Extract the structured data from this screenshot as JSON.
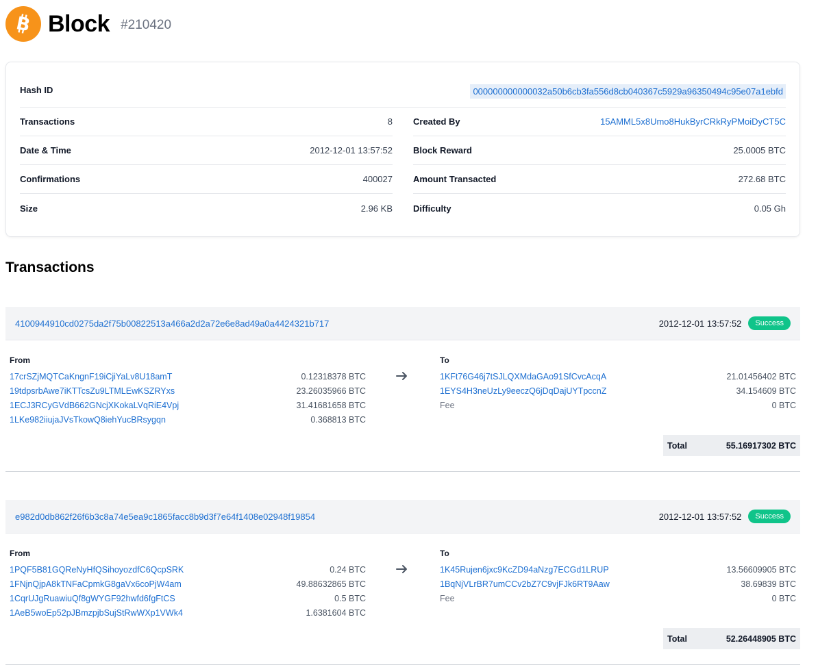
{
  "header": {
    "title": "Block",
    "block_number": "#210420"
  },
  "summary": {
    "hash_label": "Hash ID",
    "hash_value": "000000000000032a50b6cb3fa556d8cb040367c5929a96350494c95e07a1ebfd",
    "left": [
      {
        "label": "Transactions",
        "value": "8"
      },
      {
        "label": "Date & Time",
        "value": "2012-12-01 13:57:52"
      },
      {
        "label": "Confirmations",
        "value": "400027"
      },
      {
        "label": "Size",
        "value": "2.96 KB"
      }
    ],
    "right": [
      {
        "label": "Created By",
        "value": "15AMML5x8Umo8HukByrCRkRyPMoiDyCT5C"
      },
      {
        "label": "Block Reward",
        "value": "25.0005 BTC"
      },
      {
        "label": "Amount Transacted",
        "value": "272.68 BTC"
      },
      {
        "label": "Difficulty",
        "value": "0.05 Gh"
      }
    ]
  },
  "transactions_title": "Transactions",
  "labels": {
    "from": "From",
    "to": "To",
    "total": "Total"
  },
  "transactions": [
    {
      "hash": "4100944910cd0275da2f75b00822513a466a2d2a72e6e8ad49a0a4424321b717",
      "time": "2012-12-01 13:57:52",
      "status": "Success",
      "inputs": [
        {
          "address": "17crSZjMQTCaKngnF19iCjiYaLv8U18amT",
          "amount": "0.12318378 BTC"
        },
        {
          "address": "19tdpsrbAwe7iKTTcsZu9LTMLEwKSZRYxs",
          "amount": "23.26035966 BTC"
        },
        {
          "address": "1ECJ3RCyGVdB662GNcjXKokaLVqRiE4Vpj",
          "amount": "31.41681658 BTC"
        },
        {
          "address": "1LKe982iiujaJVsTkowQ8iehYucBRsygqn",
          "amount": "0.368813 BTC"
        }
      ],
      "outputs": [
        {
          "address": "1KFt76G46j7tSJLQXMdaGAo91SfCvcAcqA",
          "amount": "21.01456402 BTC"
        },
        {
          "address": "1EYS4H3neUzLy9eeczQ6jDqDajUYTpccnZ",
          "amount": "34.154609 BTC"
        }
      ],
      "fee_label": "Fee",
      "fee": "0 BTC",
      "total": "55.16917302 BTC"
    },
    {
      "hash": "e982d0db862f26f6b3c8a74e5ea9c1865facc8b9d3f7e64f1408e02948f19854",
      "time": "2012-12-01 13:57:52",
      "status": "Success",
      "inputs": [
        {
          "address": "1PQF5B81GQReNyHfQSihoyozdfC6QcpSRK",
          "amount": "0.24 BTC"
        },
        {
          "address": "1FNjnQjpA8kTNFaCpmkG8gaVx6coPjW4am",
          "amount": "49.88632865 BTC"
        },
        {
          "address": "1CqrUJgRuawiuQf8gWYGF92hwfd6fgFtCS",
          "amount": "0.5 BTC"
        },
        {
          "address": "1AeB5woEp52pJBmzpjbSujStRwWXp1VWk4",
          "amount": "1.6381604 BTC"
        }
      ],
      "outputs": [
        {
          "address": "1K45Rujen6jxc9KcZD94aNzg7ECGd1LRUP",
          "amount": "13.56609905 BTC"
        },
        {
          "address": "1BqNjVLrBR7umCCv2bZ7C9vjFJk6RT9Aaw",
          "amount": "38.69839 BTC"
        }
      ],
      "fee_label": "Fee",
      "fee": "0 BTC",
      "total": "52.26448905 BTC"
    }
  ]
}
